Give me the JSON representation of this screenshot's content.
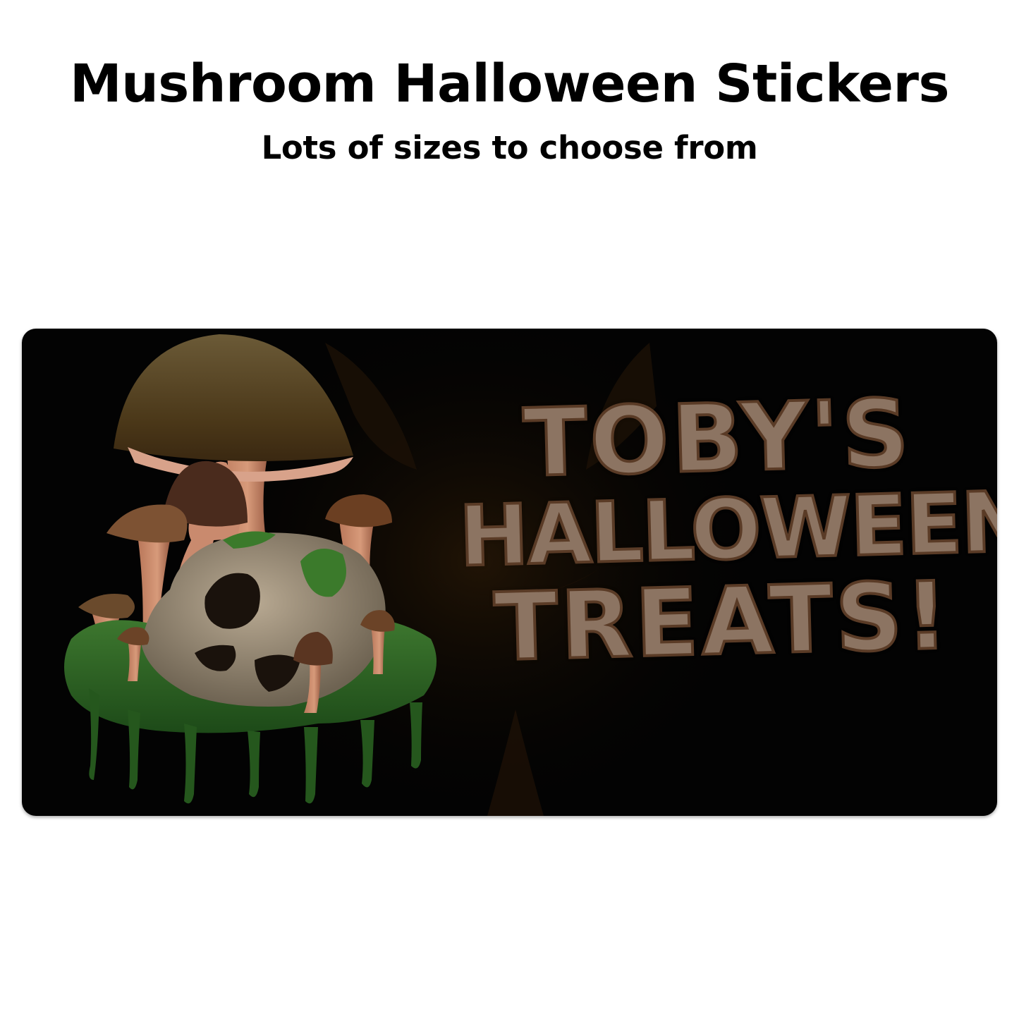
{
  "header": {
    "title": "Mushroom Halloween Stickers",
    "subtitle": "Lots of sizes to choose from"
  },
  "sticker": {
    "lines": [
      "TOBY'S",
      "HALLOWEEN",
      "TREATS!"
    ],
    "text_color": "#8c7462",
    "outline_color": "#5a3b26",
    "background_color": "#030303",
    "illustration": "mushroom-skull-moss-icon",
    "background_motif": "jack-o-lantern-face-icon"
  }
}
